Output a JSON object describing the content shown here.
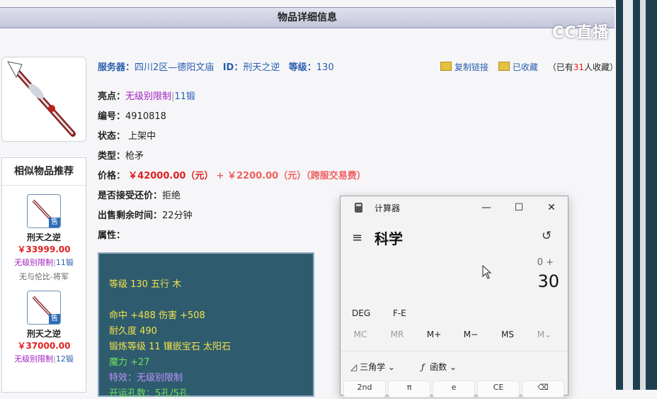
{
  "header": {
    "title": "物品详细信息"
  },
  "watermark": "CC直播",
  "similar": {
    "title": "相似物品推荐",
    "items": [
      {
        "name": "刑天之逆",
        "price": "￥33999.00",
        "tag1": "无级别限制",
        "sep": "|",
        "tag2": "11锻",
        "sub": "无与伦比-将军",
        "badge": "售"
      },
      {
        "name": "刑天之逆",
        "price": "￥37000.00",
        "tag1": "无级别限制",
        "sep": "|",
        "tag2": "12锻",
        "sub": "",
        "badge": "售"
      }
    ]
  },
  "info": {
    "server_label": "服务器：",
    "server": "四川2区—德阳文庙",
    "id_label": "ID：",
    "id": "刑天之逆",
    "level_label": "等级：",
    "level": "130",
    "copy_link": "复制链接",
    "favorited": "已收藏",
    "fav_count_prefix": "（已有",
    "fav_count": "31",
    "fav_count_suffix": "人收藏）",
    "highlight_label": "亮点：",
    "highlight_1": "无级别限制",
    "highlight_sep": "|",
    "highlight_2": "11锻",
    "number_label": "编号：",
    "number": "4910818",
    "status_label": "状态：",
    "status": "上架中",
    "type_label": "类型：",
    "type": "枪矛",
    "price_label": "价格：",
    "price": "￥42000.00（元）",
    "fee": "+ ￥2200.00（元）（跨服交易费）",
    "bargain_label": "是否接受还价：",
    "bargain": "拒绝",
    "time_label": "出售剩余时间：",
    "time": "22分钟",
    "attr_label": "属性："
  },
  "attributes": {
    "line1": "等级 130 五行 木",
    "line2": "命中 +488 伤害 +508",
    "line3": "耐久度 490",
    "line4": "锻炼等级 11 镶嵌宝石 太阳石",
    "line5": "魔力 +27",
    "line6": "特效：无级别限制",
    "line7": "开运孔数：5孔/5孔"
  },
  "calculator": {
    "app_title": "计算器",
    "mode": "科学",
    "expression": "0 +",
    "display": "30",
    "deg": "DEG",
    "fe": "F-E",
    "mem": [
      "MC",
      "MR",
      "M+",
      "M−",
      "MS",
      "M⌄"
    ],
    "trig": "三角学",
    "func": "函数",
    "keys": [
      "2nd",
      "π",
      "e",
      "CE",
      "⌫"
    ],
    "minimize": "—",
    "maximize": "☐",
    "close": "✕",
    "menu": "≡",
    "history": "↺"
  }
}
